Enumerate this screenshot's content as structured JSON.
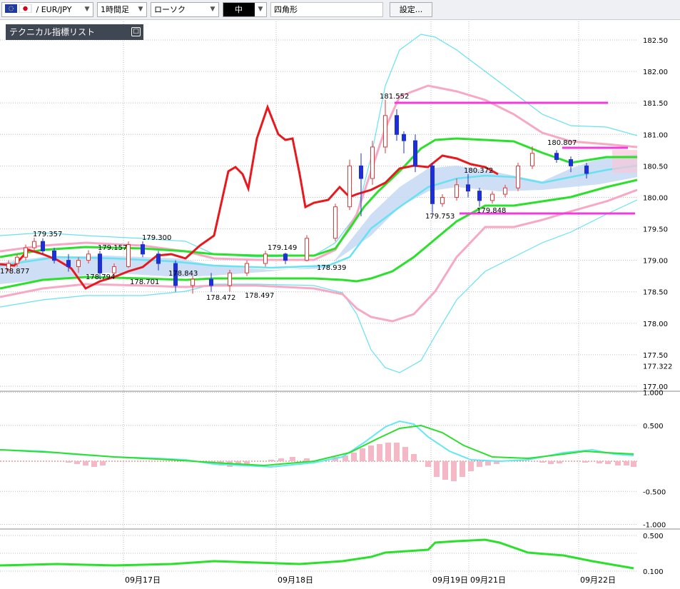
{
  "toolbar": {
    "symbol": "/ EUR/JPY",
    "timeframe": "1時間足",
    "chart_type": "ローソク",
    "draw_mode_icon": "中",
    "shape_tool": "四角形",
    "settings_button": "設定..."
  },
  "indicator_panel": {
    "title": "テクニカル指標リスト",
    "button": "□"
  },
  "price_axis": {
    "labels": [
      "182.50",
      "182.00",
      "181.50",
      "181.00",
      "180.50",
      "180.00",
      "179.50",
      "179.00",
      "178.50",
      "178.00",
      "177.50",
      "177.322",
      "177.00"
    ]
  },
  "macd_axis": {
    "labels": [
      "1.000",
      "0.500",
      "-0.500",
      "-1.000"
    ]
  },
  "lower_axis": {
    "labels": [
      "0.500",
      "0.100"
    ]
  },
  "date_axis": {
    "labels": [
      "09月17日",
      "09月18日",
      "09月19日",
      "09月21日",
      "09月22日"
    ]
  },
  "annotations": {
    "labels": [
      "179.357",
      "179.157",
      "179.300",
      "179.149",
      "181.552",
      "180.807",
      "180.372",
      "178.877",
      "178.794",
      "178.701",
      "178.843",
      "178.472",
      "178.497",
      "178.939",
      "179.753",
      "179.848"
    ]
  },
  "colors": {
    "candle_up": "#e23a3a",
    "candle_down": "#1c2fd8",
    "bollinger_outer": "#66e2f2",
    "bollinger_mid": "#f7a8c5",
    "envelope": "#2be02b",
    "ma": "#e8181c",
    "cloud": "#c4d8f3",
    "horizontal_line": "#f23ae0",
    "grid": "#b8bcc4"
  },
  "chart_data": {
    "type": "candlestick",
    "price_range": [
      177.0,
      182.5
    ],
    "candles": [
      {
        "o": 178.85,
        "h": 179.0,
        "l": 178.82,
        "c": 178.95
      },
      {
        "o": 178.95,
        "h": 179.1,
        "l": 178.9,
        "c": 179.05
      },
      {
        "o": 179.05,
        "h": 179.25,
        "l": 179.0,
        "c": 179.2
      },
      {
        "o": 179.2,
        "h": 179.36,
        "l": 179.15,
        "c": 179.3
      },
      {
        "o": 179.3,
        "h": 179.35,
        "l": 179.1,
        "c": 179.15
      },
      {
        "o": 179.15,
        "h": 179.2,
        "l": 178.95,
        "c": 179.0
      },
      {
        "o": 179.0,
        "h": 179.1,
        "l": 178.82,
        "c": 178.9
      },
      {
        "o": 178.9,
        "h": 179.05,
        "l": 178.8,
        "c": 179.0
      },
      {
        "o": 179.0,
        "h": 179.16,
        "l": 178.95,
        "c": 179.1
      },
      {
        "o": 179.1,
        "h": 179.15,
        "l": 178.7,
        "c": 178.8
      },
      {
        "o": 178.8,
        "h": 178.95,
        "l": 178.72,
        "c": 178.9
      },
      {
        "o": 178.9,
        "h": 179.3,
        "l": 178.88,
        "c": 179.25
      },
      {
        "o": 179.25,
        "h": 179.3,
        "l": 179.05,
        "c": 179.1
      },
      {
        "o": 179.1,
        "h": 179.15,
        "l": 178.84,
        "c": 178.95
      },
      {
        "o": 178.95,
        "h": 179.0,
        "l": 178.5,
        "c": 178.6
      },
      {
        "o": 178.6,
        "h": 178.75,
        "l": 178.47,
        "c": 178.7
      },
      {
        "o": 178.7,
        "h": 178.8,
        "l": 178.5,
        "c": 178.6
      },
      {
        "o": 178.6,
        "h": 178.85,
        "l": 178.5,
        "c": 178.8
      },
      {
        "o": 178.8,
        "h": 179.0,
        "l": 178.75,
        "c": 178.95
      },
      {
        "o": 178.95,
        "h": 179.15,
        "l": 178.9,
        "c": 179.1
      },
      {
        "o": 179.1,
        "h": 179.12,
        "l": 178.94,
        "c": 179.0
      },
      {
        "o": 179.0,
        "h": 179.4,
        "l": 178.98,
        "c": 179.35
      },
      {
        "o": 179.35,
        "h": 179.9,
        "l": 179.3,
        "c": 179.85
      },
      {
        "o": 179.85,
        "h": 180.6,
        "l": 179.8,
        "c": 180.5
      },
      {
        "o": 180.5,
        "h": 180.7,
        "l": 179.7,
        "c": 180.3
      },
      {
        "o": 180.3,
        "h": 180.9,
        "l": 180.2,
        "c": 180.8
      },
      {
        "o": 180.8,
        "h": 181.55,
        "l": 180.7,
        "c": 181.3
      },
      {
        "o": 181.3,
        "h": 181.4,
        "l": 180.9,
        "c": 181.0
      },
      {
        "o": 181.0,
        "h": 181.05,
        "l": 180.7,
        "c": 180.9
      },
      {
        "o": 180.9,
        "h": 181.0,
        "l": 180.4,
        "c": 180.5
      },
      {
        "o": 180.5,
        "h": 180.55,
        "l": 179.75,
        "c": 179.9
      },
      {
        "o": 179.9,
        "h": 180.05,
        "l": 179.85,
        "c": 180.0
      },
      {
        "o": 180.0,
        "h": 180.3,
        "l": 179.95,
        "c": 180.2
      },
      {
        "o": 180.2,
        "h": 180.37,
        "l": 180.0,
        "c": 180.1
      },
      {
        "o": 180.1,
        "h": 180.15,
        "l": 179.85,
        "c": 179.95
      },
      {
        "o": 179.95,
        "h": 180.1,
        "l": 179.9,
        "c": 180.05
      },
      {
        "o": 180.05,
        "h": 180.2,
        "l": 180.0,
        "c": 180.15
      },
      {
        "o": 180.15,
        "h": 180.55,
        "l": 180.1,
        "c": 180.5
      },
      {
        "o": 180.5,
        "h": 180.81,
        "l": 180.45,
        "c": 180.7
      },
      {
        "o": 180.7,
        "h": 180.75,
        "l": 180.55,
        "c": 180.6
      },
      {
        "o": 180.6,
        "h": 180.65,
        "l": 180.4,
        "c": 180.5
      },
      {
        "o": 180.5,
        "h": 180.55,
        "l": 180.3,
        "c": 180.38
      }
    ],
    "ma_red": [
      178.9,
      178.8,
      178.6,
      178.7,
      178.85,
      178.9,
      179.05,
      179.35,
      179.95,
      180.5,
      180.15,
      180.95,
      181.4,
      180.95,
      180.9,
      179.9,
      180.05,
      180.0,
      180.4,
      180.2,
      180.55,
      180.5,
      180.6,
      180.4,
      180.3,
      180.45
    ],
    "macd": {
      "ylim": [
        -1.0,
        1.0
      ]
    },
    "lower": {
      "ylim": [
        0.1,
        0.5
      ]
    }
  }
}
